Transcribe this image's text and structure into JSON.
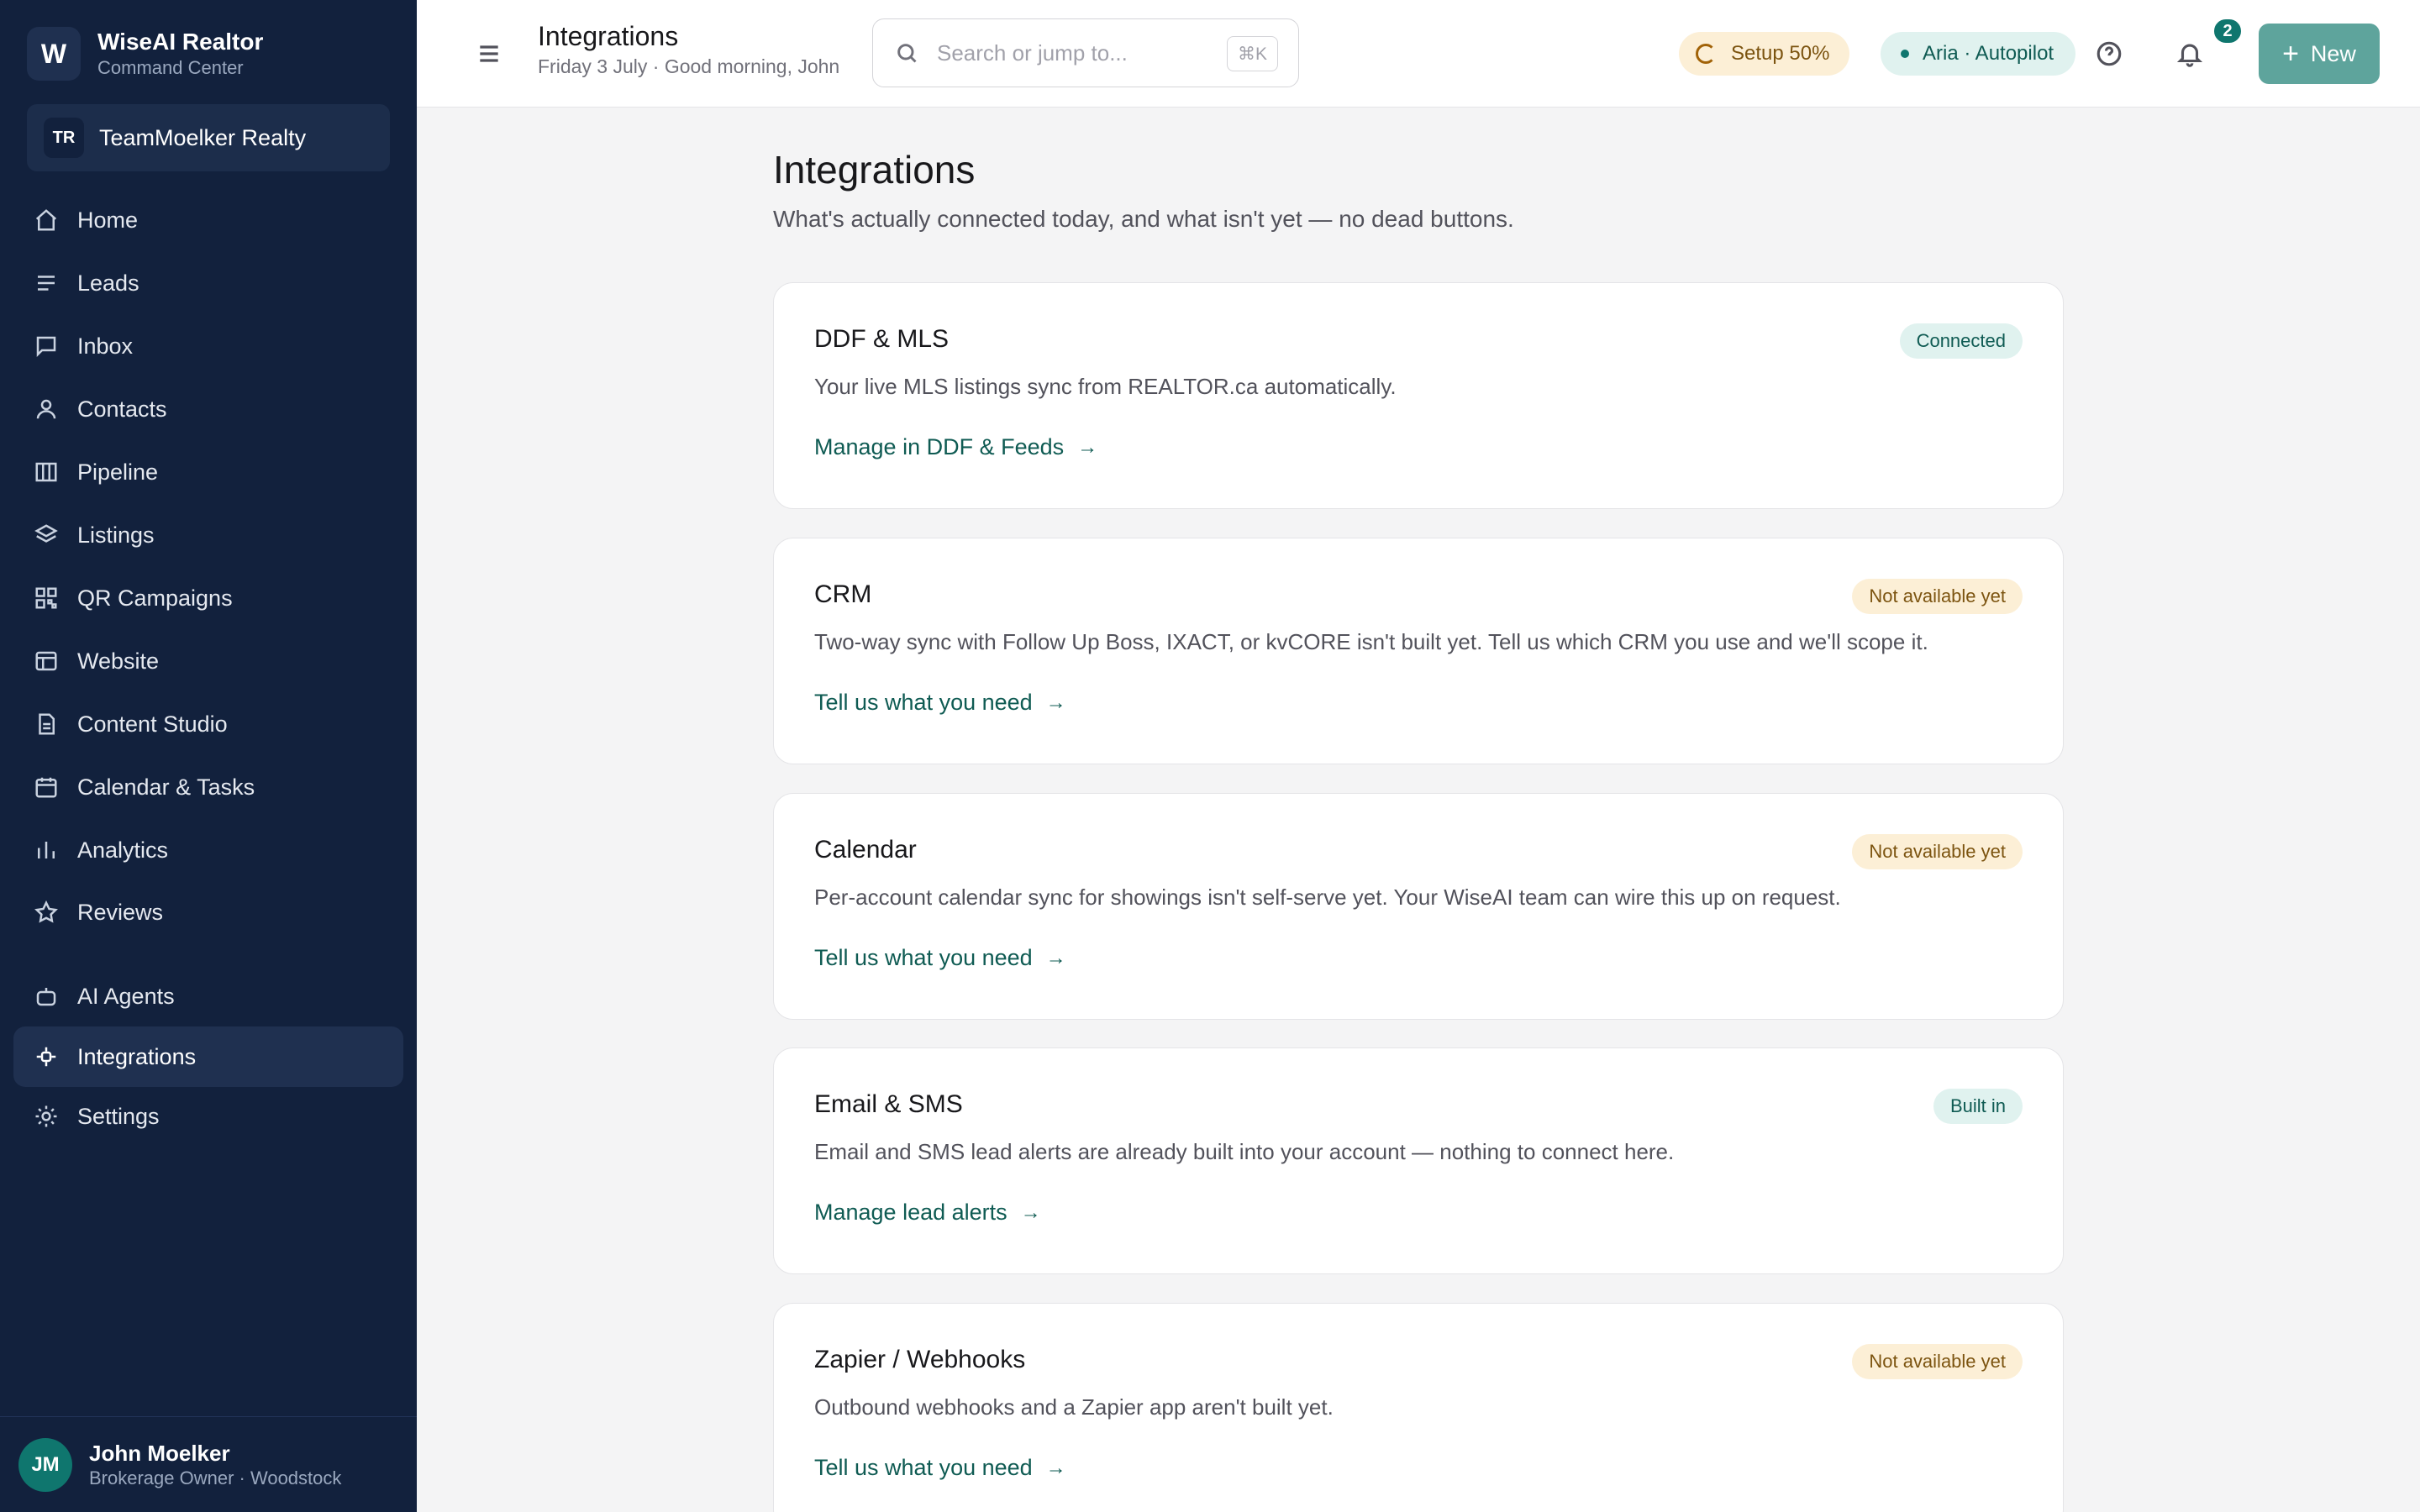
{
  "brand": {
    "logo_letter": "W",
    "name": "WiseAI Realtor",
    "subtitle": "Command Center"
  },
  "team": {
    "initials": "TR",
    "name": "TeamMoelker Realty"
  },
  "sidebar": {
    "items": [
      {
        "label": "Home",
        "icon": "home-icon"
      },
      {
        "label": "Leads",
        "icon": "list-icon"
      },
      {
        "label": "Inbox",
        "icon": "message-icon"
      },
      {
        "label": "Contacts",
        "icon": "user-icon"
      },
      {
        "label": "Pipeline",
        "icon": "columns-icon"
      },
      {
        "label": "Listings",
        "icon": "layers-icon"
      },
      {
        "label": "QR Campaigns",
        "icon": "qr-icon"
      },
      {
        "label": "Website",
        "icon": "layout-icon"
      },
      {
        "label": "Content Studio",
        "icon": "document-icon"
      },
      {
        "label": "Calendar & Tasks",
        "icon": "calendar-icon"
      },
      {
        "label": "Analytics",
        "icon": "bar-chart-icon"
      },
      {
        "label": "Reviews",
        "icon": "star-icon"
      },
      {
        "label": "AI Agents",
        "icon": "bot-icon"
      },
      {
        "label": "Integrations",
        "icon": "puzzle-icon",
        "active": true
      },
      {
        "label": "Settings",
        "icon": "gear-icon"
      }
    ]
  },
  "user": {
    "initials": "JM",
    "name": "John Moelker",
    "role": "Brokerage Owner · Woodstock"
  },
  "header": {
    "title": "Integrations",
    "subtitle": "Friday 3 July · Good morning, John",
    "search_placeholder": "Search or jump to...",
    "search_shortcut": "⌘K",
    "setup_label": "Setup 50%",
    "setup_progress": 0.5,
    "aria_label": "Aria · Autopilot",
    "notifications_count": "2",
    "new_label": "New"
  },
  "main": {
    "title": "Integrations",
    "subtitle": "What's actually connected today, and what isn't yet — no dead buttons.",
    "cards": [
      {
        "title": "DDF & MLS",
        "status": "Connected",
        "status_type": "ok",
        "description": "Your live MLS listings sync from REALTOR.ca automatically.",
        "link": "Manage in DDF & Feeds"
      },
      {
        "title": "CRM",
        "status": "Not available yet",
        "status_type": "warn",
        "description": "Two-way sync with Follow Up Boss, IXACT, or kvCORE isn't built yet. Tell us which CRM you use and we'll scope it.",
        "link": "Tell us what you need"
      },
      {
        "title": "Calendar",
        "status": "Not available yet",
        "status_type": "warn",
        "description": "Per-account calendar sync for showings isn't self-serve yet. Your WiseAI team can wire this up on request.",
        "link": "Tell us what you need"
      },
      {
        "title": "Email & SMS",
        "status": "Built in",
        "status_type": "ok",
        "description": "Email and SMS lead alerts are already built into your account — nothing to connect here.",
        "link": "Manage lead alerts"
      },
      {
        "title": "Zapier / Webhooks",
        "status": "Not available yet",
        "status_type": "warn",
        "description": "Outbound webhooks and a Zapier app aren't built yet.",
        "link": "Tell us what you need"
      }
    ]
  },
  "colors": {
    "sidebar_bg": "#12213d",
    "accent": "#0f766e",
    "new_button": "#5ea49c",
    "warn_bg": "#fcefd6",
    "ok_bg": "#e0f2ef"
  }
}
